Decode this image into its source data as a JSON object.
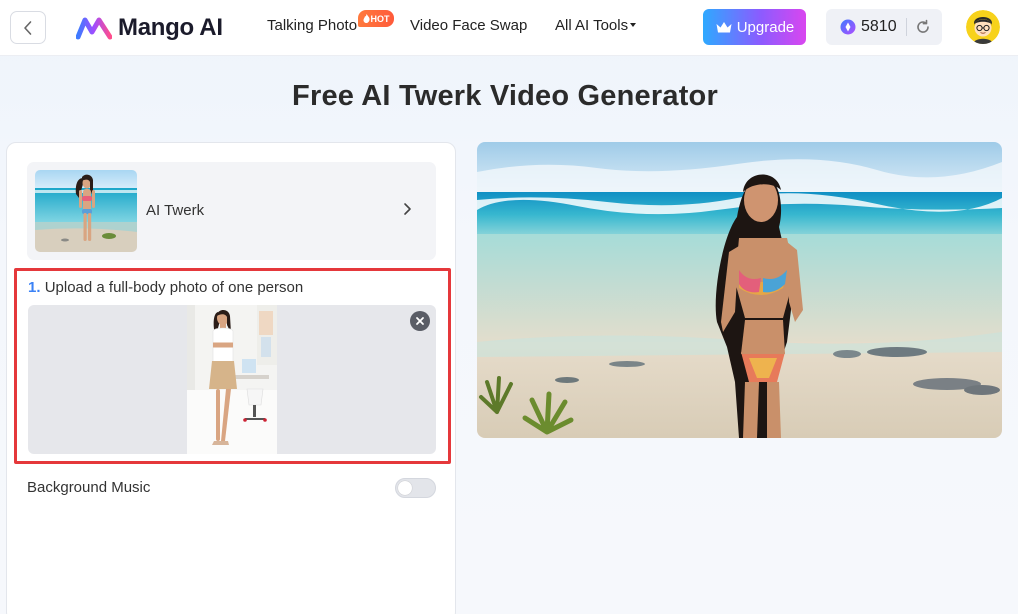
{
  "header": {
    "logo_text": "Mango AI",
    "nav": {
      "talking_photo": "Talking Photo",
      "hot_badge": "HOT",
      "video_face_swap": "Video Face Swap",
      "all_ai_tools": "All AI Tools"
    },
    "upgrade_label": "Upgrade",
    "credits": "5810"
  },
  "page": {
    "title": "Free AI Twerk Video Generator"
  },
  "template": {
    "label": "AI Twerk"
  },
  "upload": {
    "step_number": "1.",
    "label": "Upload a full-body photo of one person"
  },
  "settings": {
    "background_music_label": "Background Music",
    "background_music_enabled": false
  },
  "colors": {
    "accent_blue": "#3b82f6",
    "highlight_red": "#e5383b",
    "upgrade_gradient_start": "#2ea9ff",
    "upgrade_gradient_end": "#d946ef"
  },
  "icons": [
    "chevron-left-icon",
    "crown-icon",
    "gem-icon",
    "refresh-icon",
    "chevron-right-icon",
    "close-icon",
    "fire-icon"
  ]
}
